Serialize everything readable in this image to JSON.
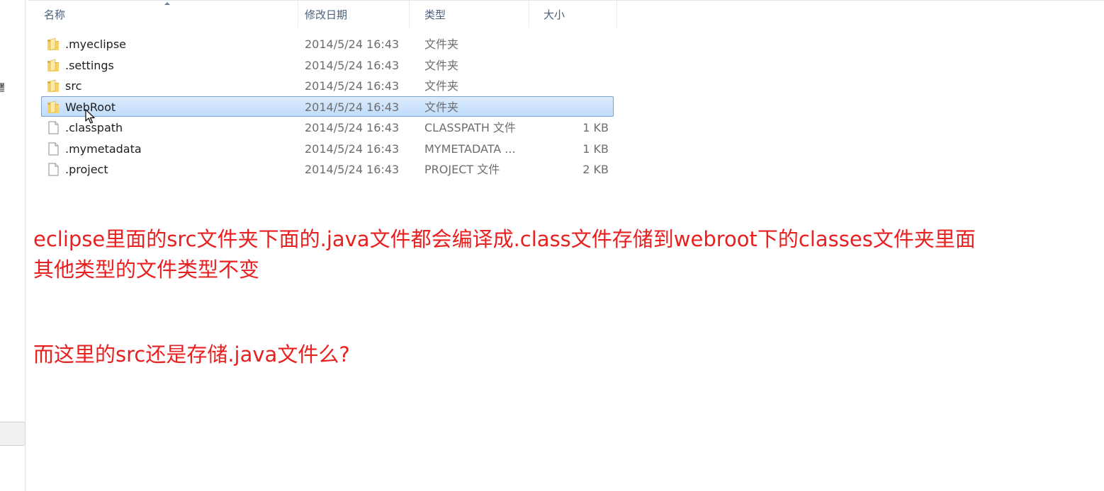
{
  "columns": {
    "name": "名称",
    "date": "修改日期",
    "type": "类型",
    "size": "大小"
  },
  "nav_glyph": "置",
  "files": [
    {
      "name": ".myeclipse",
      "date": "2014/5/24 16:43",
      "type": "文件夹",
      "size": "",
      "icon": "folder-icon",
      "selected": false
    },
    {
      "name": ".settings",
      "date": "2014/5/24 16:43",
      "type": "文件夹",
      "size": "",
      "icon": "folder-icon",
      "selected": false
    },
    {
      "name": "src",
      "date": "2014/5/24 16:43",
      "type": "文件夹",
      "size": "",
      "icon": "folder-icon",
      "selected": false
    },
    {
      "name": "WebRoot",
      "date": "2014/5/24 16:43",
      "type": "文件夹",
      "size": "",
      "icon": "folder-icon",
      "selected": true
    },
    {
      "name": ".classpath",
      "date": "2014/5/24 16:43",
      "type": "CLASSPATH 文件",
      "size": "1 KB",
      "icon": "file-icon",
      "selected": false
    },
    {
      "name": ".mymetadata",
      "date": "2014/5/24 16:43",
      "type": "MYMETADATA ...",
      "size": "1 KB",
      "icon": "file-icon",
      "selected": false
    },
    {
      "name": ".project",
      "date": "2014/5/24 16:43",
      "type": "PROJECT 文件",
      "size": "2 KB",
      "icon": "file-icon",
      "selected": false
    }
  ],
  "notes": {
    "line1": "eclipse里面的src文件夹下面的.java文件都会编译成.class文件存储到webroot下的classes文件夹里面",
    "line2": "其他类型的文件类型不变",
    "line3": "而这里的src还是存储.java文件么?"
  },
  "colors": {
    "annotation": "#e82020",
    "selection_border": "#7da2ce",
    "header_text": "#4c607a"
  }
}
